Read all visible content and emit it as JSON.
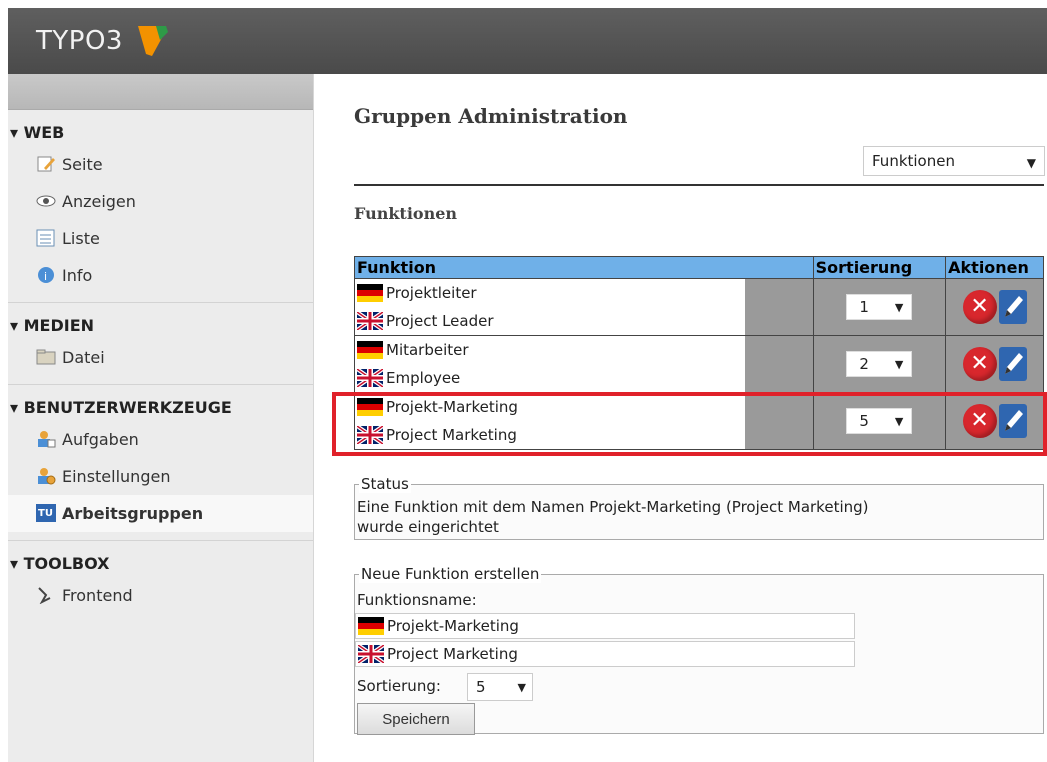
{
  "app": {
    "logo_text": "TYPO3"
  },
  "sidebar": {
    "groups": [
      {
        "title": "▾ WEB",
        "items": [
          {
            "label": "Seite",
            "icon": "page-edit-icon"
          },
          {
            "label": "Anzeigen",
            "icon": "eye-icon"
          },
          {
            "label": "Liste",
            "icon": "list-icon"
          },
          {
            "label": "Info",
            "icon": "info-icon"
          }
        ]
      },
      {
        "title": "▾ MEDIEN",
        "items": [
          {
            "label": "Datei",
            "icon": "folder-icon"
          }
        ]
      },
      {
        "title": "▾ BENUTZERWERKZEUGE",
        "items": [
          {
            "label": "Aufgaben",
            "icon": "user-tasks-icon"
          },
          {
            "label": "Einstellungen",
            "icon": "user-settings-icon"
          },
          {
            "label": "Arbeitsgruppen",
            "icon": "tu-logo-icon",
            "active": true
          }
        ]
      },
      {
        "title": "▾ TOOLBOX",
        "items": [
          {
            "label": "Frontend",
            "icon": "frontend-icon"
          }
        ]
      }
    ]
  },
  "main": {
    "title": "Gruppen Administration",
    "view_select": "Funktionen",
    "section_title": "Funktionen",
    "table": {
      "headers": {
        "name": "Funktion",
        "sort": "Sortierung",
        "actions": "Aktionen"
      },
      "rows": [
        {
          "de": "Projektleiter",
          "en": "Project Leader",
          "sort": "1"
        },
        {
          "de": "Mitarbeiter",
          "en": "Employee",
          "sort": "2"
        },
        {
          "de": "Projekt-Marketing",
          "en": "Project Marketing",
          "sort": "5"
        }
      ]
    },
    "status": {
      "legend": "Status",
      "line1": "Eine Funktion mit dem Namen Projekt-Marketing (Project Marketing)",
      "line2": "wurde eingerichtet"
    },
    "new_function": {
      "legend": "Neue Funktion erstellen",
      "name_label": "Funktionsname:",
      "de_value": "Projekt-Marketing",
      "en_value": "Project Marketing",
      "sort_label": "Sortierung:",
      "sort_value": "5",
      "save_label": "Speichern"
    }
  },
  "colors": {
    "table_header": "#6fb0e8",
    "highlight": "#e0212a",
    "delete": "#d8272d",
    "edit": "#2f66b0"
  }
}
